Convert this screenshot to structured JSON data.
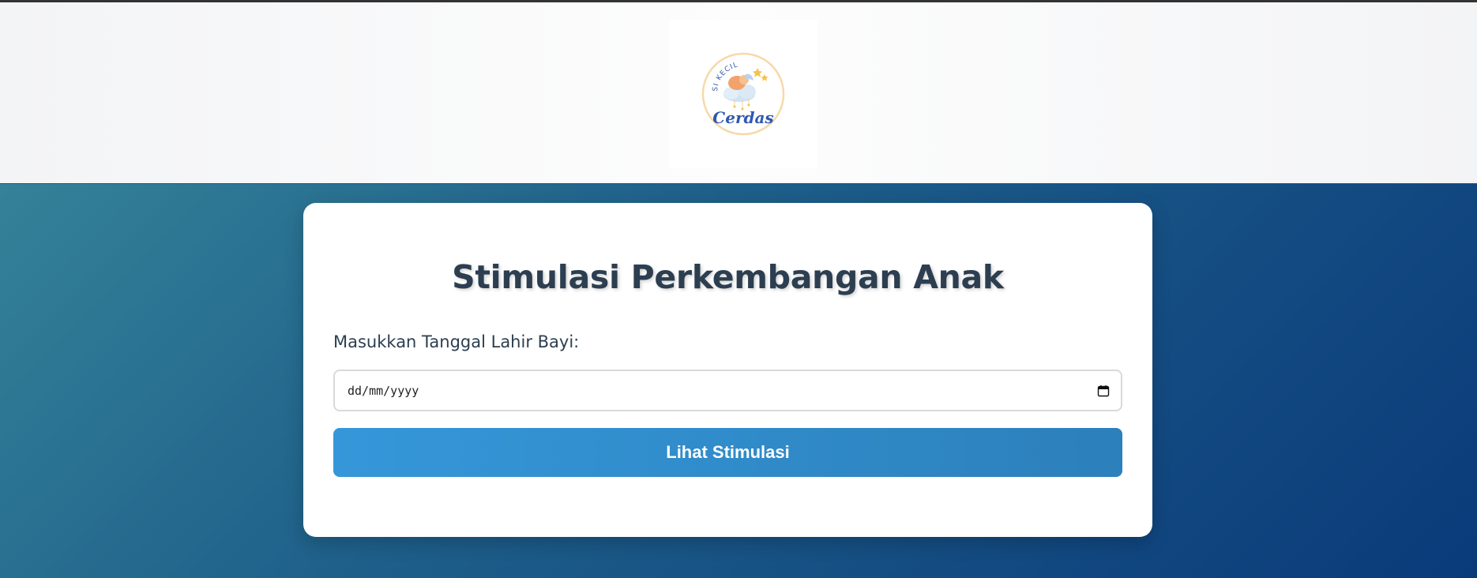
{
  "header": {
    "logo": {
      "text_top": "SI KECIL",
      "text_main": "Cerdas"
    }
  },
  "form": {
    "title": "Stimulasi Perkembangan Anak",
    "birthdate_label": "Masukkan Tanggal Lahir Bayi:",
    "birthdate_placeholder": "dd/mm/yyyy",
    "submit_label": "Lihat Stimulasi"
  },
  "colors": {
    "accent": "#3597d9",
    "title": "#2c3e50",
    "background_start": "#3a8a9c",
    "background_end": "#0a3a7a"
  },
  "icons": {
    "date_picker": "calendar-icon"
  }
}
